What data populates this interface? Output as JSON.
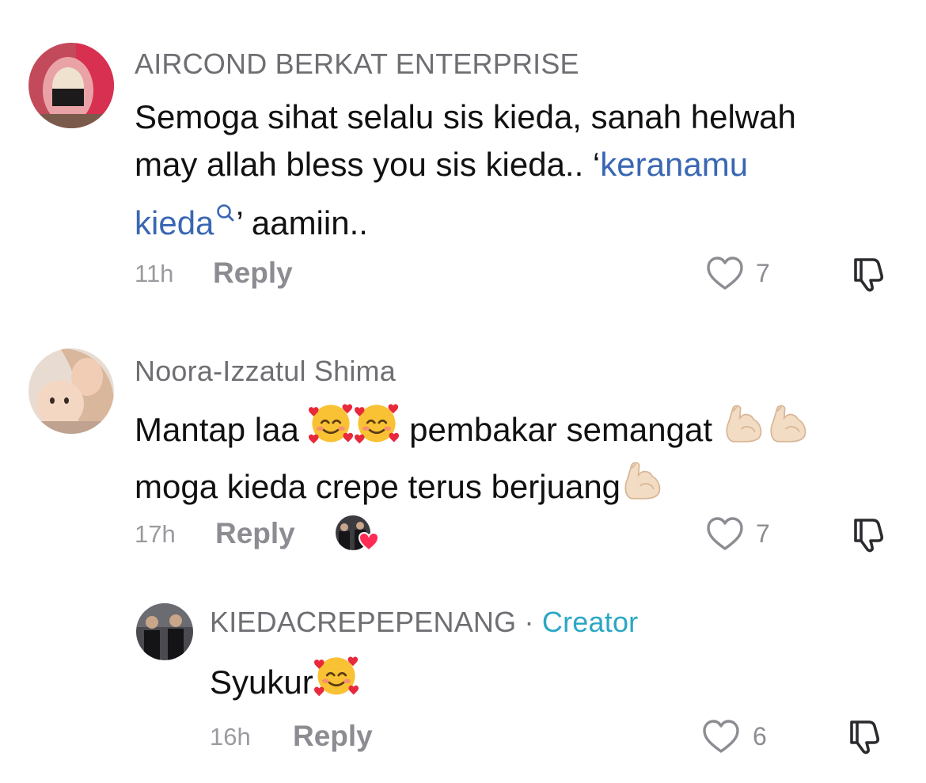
{
  "comments": [
    {
      "username": "AIRCOND BERKAT ENTERPRISE",
      "text_line1": "Semoga sihat selalu sis kieda, sanah helwah",
      "text_line2_before": "may allah bless you sis kieda.. ‘",
      "link_part1": "keranamu",
      "link_part2": "kieda",
      "text_line3_after": "’ aamiin..",
      "time": "11h",
      "reply_label": "Reply",
      "likes": "7"
    },
    {
      "username": "Noora-Izzatul Shima",
      "text_line1_a": "Mantap laa",
      "text_line1_b": "pembakar semangat",
      "text_line2": "moga kieda crepe terus berjuang",
      "time": "17h",
      "reply_label": "Reply",
      "likes": "7"
    },
    {
      "username": "KIEDACREPEPENANG",
      "separator": "·",
      "badge": "Creator",
      "text": "Syukur",
      "time": "16h",
      "reply_label": "Reply",
      "likes": "6"
    }
  ],
  "icons": {
    "like": "heart-outline-icon",
    "dislike": "thumbs-down-icon",
    "search": "search-icon",
    "smiling_hearts": "smiling-face-with-hearts-emoji",
    "flexed_biceps": "flexed-biceps-emoji"
  },
  "colors": {
    "link": "#3a67b3",
    "creator": "#2aa7c4",
    "muted": "#8c8c92"
  }
}
